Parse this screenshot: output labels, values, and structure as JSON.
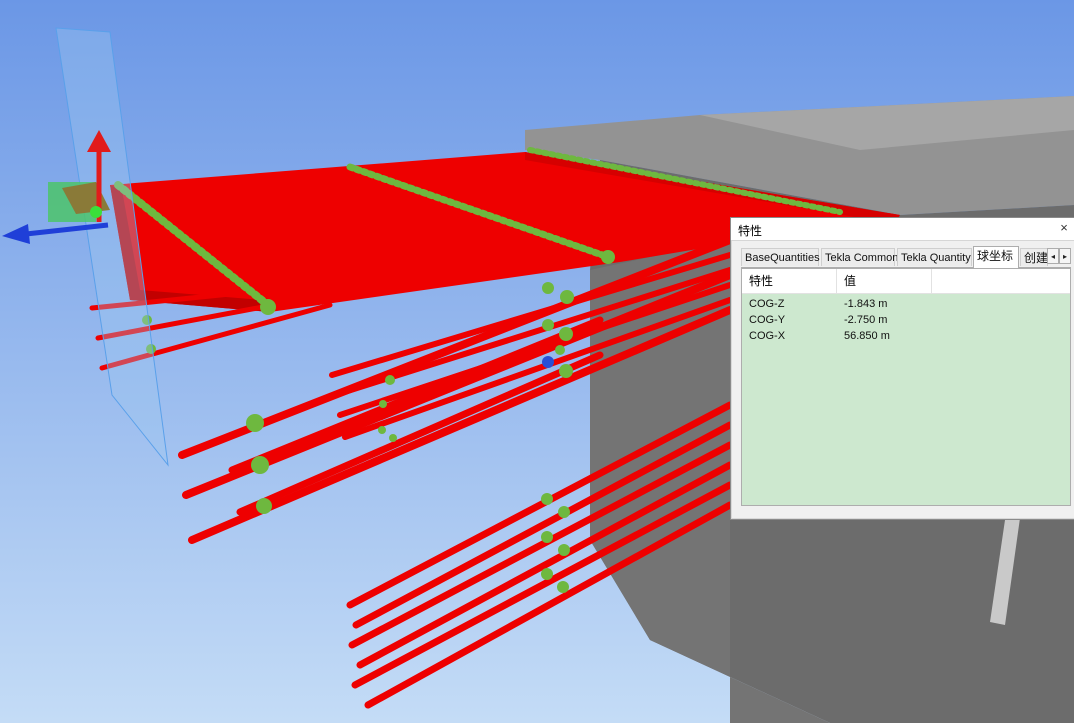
{
  "dialog": {
    "title": "特性",
    "close_glyph": "×",
    "tabs": [
      {
        "label": "BaseQuantities",
        "active": false
      },
      {
        "label": "Tekla Common",
        "active": false
      },
      {
        "label": "Tekla Quantity",
        "active": false
      },
      {
        "label": "球坐标",
        "active": true
      },
      {
        "label": "创建",
        "active": false
      }
    ],
    "tab_scroll_left": "◂",
    "tab_scroll_right": "▸",
    "columns": [
      "特性",
      "值"
    ],
    "rows": [
      {
        "name": "COG-Z",
        "value": "-1.843 m"
      },
      {
        "name": "COG-Y",
        "value": "-2.750 m"
      },
      {
        "name": "COG-X",
        "value": "56.850 m"
      }
    ]
  },
  "scene": {
    "colors": {
      "sky_top": "#6b97e6",
      "sky_bottom": "#c4dcf6",
      "rebar": "#ee0000",
      "rebar_dark": "#b50000",
      "node": "#6eb83f",
      "selected_node": "#2a4fd6",
      "concrete_top": "#8d8d8d",
      "concrete_side": "#6a6a6a",
      "grid_bg": "#cde8cf",
      "axis_z": "#e11b1b",
      "axis_x": "#1f3fd8",
      "plane": "#9fc8f0"
    }
  }
}
